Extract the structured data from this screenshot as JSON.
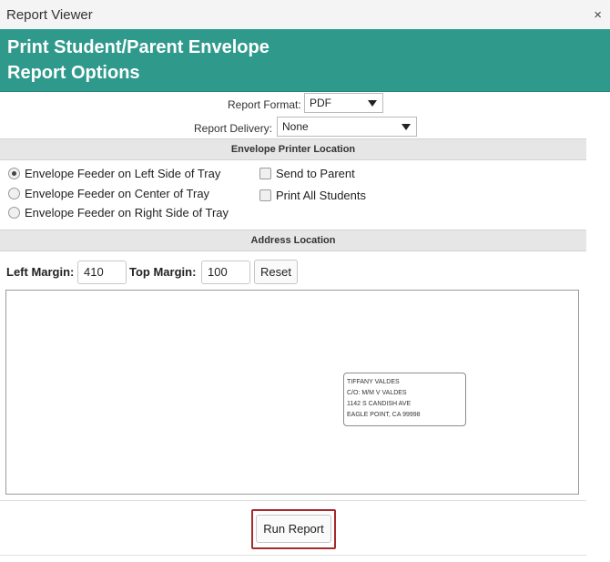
{
  "window": {
    "title": "Report Viewer",
    "close_symbol": "×"
  },
  "banner": {
    "line1": "Print Student/Parent Envelope",
    "line2": "Report Options"
  },
  "report_format": {
    "label": "Report Format:",
    "value": "PDF"
  },
  "report_delivery": {
    "label": "Report Delivery:",
    "value": "None"
  },
  "printer_location": {
    "header": "Envelope Printer Location",
    "options": [
      {
        "label": "Envelope Feeder on Left Side of Tray",
        "checked": true
      },
      {
        "label": "Envelope Feeder on Center of Tray",
        "checked": false
      },
      {
        "label": "Envelope Feeder on Right Side of Tray",
        "checked": false
      }
    ],
    "checkboxes": [
      {
        "label": "Send to Parent",
        "checked": false
      },
      {
        "label": "Print All Students",
        "checked": false
      }
    ]
  },
  "address_location": {
    "header": "Address Location",
    "left_margin_label": "Left Margin:",
    "left_margin_value": "410",
    "top_margin_label": "Top Margin:",
    "top_margin_value": "100",
    "reset_label": "Reset"
  },
  "envelope_address": {
    "lines": [
      "TIFFANY VALDES",
      "C/O: M/M V VALDES",
      "1142 S CANDISH AVE",
      "EAGLE POINT, CA 99998"
    ]
  },
  "footer": {
    "run_label": "Run Report"
  },
  "colors": {
    "banner": "#2f9a8c",
    "highlight": "#a82a2a"
  }
}
